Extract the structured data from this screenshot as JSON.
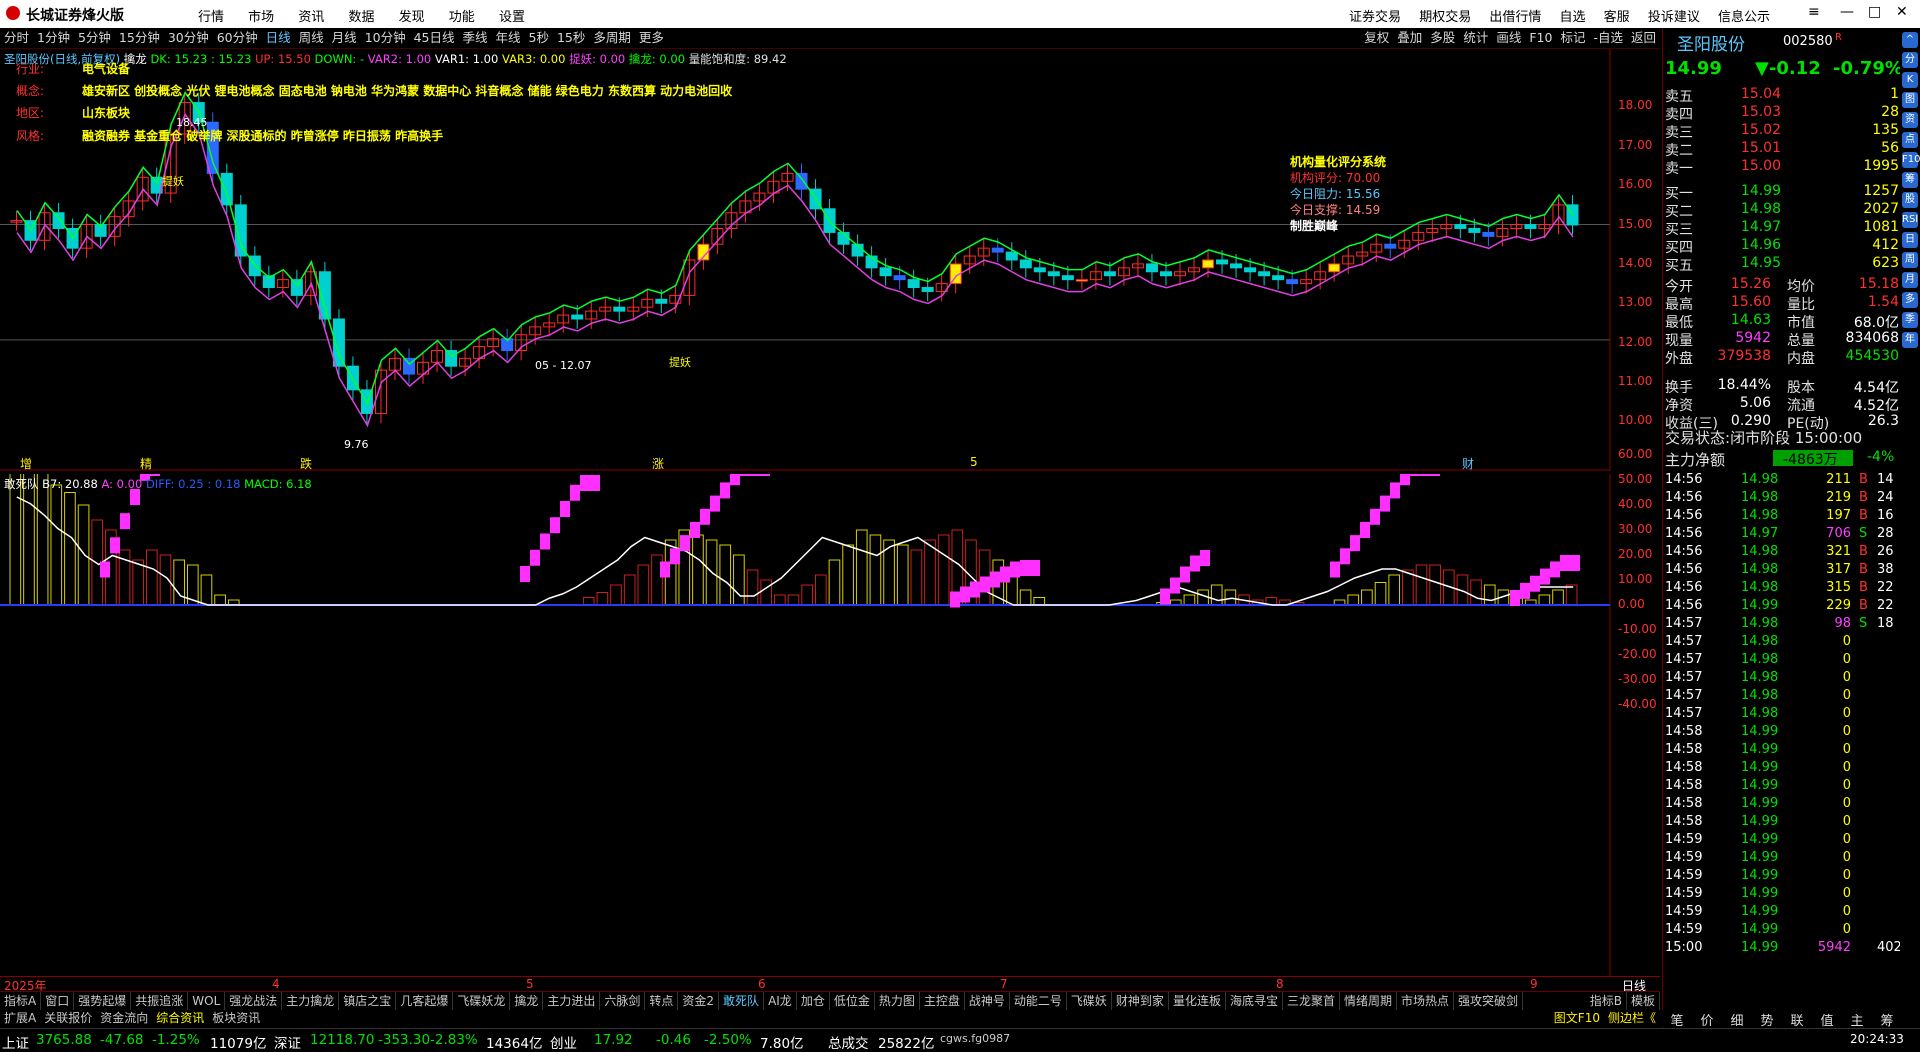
{
  "titlebar": {
    "app": "长城证券烽火版",
    "menu": [
      "行情",
      "市场",
      "资讯",
      "数据",
      "发现",
      "功能",
      "设置"
    ],
    "right_menu": [
      "证券交易",
      "期权交易",
      "出借行情",
      "自选",
      "客服",
      "投诉建议",
      "信息公示"
    ]
  },
  "periods": [
    "分时",
    "1分钟",
    "5分钟",
    "15分钟",
    "30分钟",
    "60分钟",
    "日线",
    "周线",
    "月线",
    "10分钟",
    "45日线",
    "季线",
    "年线",
    "5秒",
    "15秒",
    "多周期",
    "更多"
  ],
  "selected_period": "日线",
  "tools": [
    "复权",
    "叠加",
    "多股",
    "统计",
    "画线",
    "F10",
    "标记",
    "-自选",
    "返回"
  ],
  "kline": {
    "header": [
      {
        "t": "圣阳股份(日线,前复权)",
        "c": "#5ac8ff"
      },
      {
        "t": "  擒龙 ",
        "c": "#ffffff"
      },
      {
        "t": "DK: 15.23 : 15.23 ",
        "c": "#00ff00"
      },
      {
        "t": "UP: 15.50 ",
        "c": "#ff3030"
      },
      {
        "t": "DOWN: - ",
        "c": "#00ff00"
      },
      {
        "t": "VAR2: 1.00 ",
        "c": "#ff40ff"
      },
      {
        "t": "VAR1: 1.00 ",
        "c": "#ffffff"
      },
      {
        "t": "VAR3: 0.00 ",
        "c": "#ffff00"
      },
      {
        "t": "捉妖: 0.00 ",
        "c": "#ff40ff"
      },
      {
        "t": "擒龙: 0.00 ",
        "c": "#00ff00"
      },
      {
        "t": "量能饱和度: 89.42",
        "c": "#e0e0e0"
      }
    ],
    "info": [
      {
        "label": "行业:",
        "value": "电气设备"
      },
      {
        "label": "概念:",
        "value": "雄安新区 创投概念 光伏 锂电池概念 固态电池 钠电池 华为鸿蒙 数据中心 抖音概念 储能 绿色电力 东数西算 动力电池回收"
      },
      {
        "label": "地区:",
        "value": "山东板块"
      },
      {
        "label": "风格:",
        "value": "融资融券 基金重仓 破举牌 深股通标的 昨曾涨停 昨日振荡 昨高换手"
      }
    ],
    "y_ticks": [
      "18.00",
      "17.00",
      "16.00",
      "15.00",
      "14.00",
      "13.00",
      "12.00",
      "11.00",
      "10.00"
    ],
    "score": {
      "title": "机构量化评分系统",
      "rows": [
        {
          "label": "机构评分: ",
          "value": "70.00",
          "color": "#ff3030"
        },
        {
          "label": "今日阻力: ",
          "value": "15.56",
          "color": "#5ac8ff"
        },
        {
          "label": "今日支撑: ",
          "value": "14.59",
          "color": "#ff8080"
        }
      ],
      "footer": "制胜巅峰"
    },
    "annotations": {
      "high": "18.45",
      "low": "9.76",
      "range": "05 - 12.07",
      "tag1": "提妖",
      "tag2": "提妖"
    },
    "bottom_marks": [
      "增",
      "精",
      "跌",
      "涨",
      "5",
      "财"
    ]
  },
  "macd": {
    "header": [
      {
        "t": "敢死队 ",
        "c": "#ffffff"
      },
      {
        "t": "B7: 20.88 ",
        "c": "#ffffff"
      },
      {
        "t": "A: 0.00 ",
        "c": "#ff40ff"
      },
      {
        "t": "DIFF: 0.25 : 0.18 ",
        "c": "#2a5aff"
      },
      {
        "t": "MACD: 6.18",
        "c": "#00ff00"
      }
    ],
    "y_ticks": [
      "60.00",
      "50.00",
      "40.00",
      "30.00",
      "20.00",
      "10.00",
      "0.00",
      "-10.00",
      "-20.00",
      "-30.00",
      "-40.00"
    ]
  },
  "x_axis": {
    "year": "2025年",
    "months": [
      "4",
      "5",
      "6",
      "7",
      "8",
      "9"
    ],
    "mode": "日线"
  },
  "chart_data": {
    "type": "candlestick",
    "title": "圣阳股份(日线,前复权)",
    "ylim": [
      9.5,
      18.8
    ],
    "note": "approximate daily close path",
    "close": [
      15.1,
      14.6,
      15.3,
      14.9,
      14.4,
      15.0,
      14.7,
      15.2,
      15.6,
      16.2,
      15.8,
      17.3,
      18.1,
      17.6,
      16.3,
      15.5,
      14.2,
      13.7,
      13.4,
      13.6,
      13.2,
      13.8,
      12.6,
      11.4,
      10.8,
      10.2,
      11.3,
      11.6,
      11.2,
      11.5,
      11.8,
      11.4,
      11.6,
      11.9,
      12.1,
      11.8,
      12.2,
      12.4,
      12.5,
      12.7,
      12.6,
      12.8,
      12.9,
      12.8,
      12.9,
      13.1,
      13.0,
      13.2,
      14.1,
      14.5,
      14.9,
      15.3,
      15.6,
      15.8,
      16.1,
      16.3,
      15.9,
      15.4,
      14.8,
      14.5,
      14.2,
      13.9,
      13.7,
      13.6,
      13.4,
      13.3,
      13.5,
      14.0,
      14.2,
      14.4,
      14.3,
      14.1,
      13.9,
      13.8,
      13.7,
      13.6,
      13.6,
      13.8,
      13.7,
      13.9,
      14.0,
      13.8,
      13.7,
      13.8,
      13.9,
      14.1,
      14.0,
      13.9,
      13.8,
      13.7,
      13.6,
      13.5,
      13.6,
      13.8,
      14.0,
      14.2,
      14.3,
      14.5,
      14.4,
      14.6,
      14.8,
      14.9,
      15.0,
      14.9,
      14.8,
      14.7,
      14.9,
      15.0,
      14.9,
      15.0,
      15.5,
      14.99
    ],
    "volume_bars": [
      64,
      60,
      54,
      48,
      45,
      40,
      34,
      30,
      22,
      18,
      22,
      20,
      18,
      16,
      12,
      4,
      2,
      0,
      0,
      0,
      0,
      0,
      0,
      0,
      0,
      0,
      0,
      0,
      0,
      0,
      0,
      0,
      0,
      0,
      0,
      0,
      0,
      0,
      0,
      0,
      0,
      0,
      3,
      5,
      8,
      12,
      16,
      20,
      26,
      30,
      28,
      26,
      24,
      20,
      14,
      10,
      4,
      4,
      8,
      12,
      18,
      24,
      30,
      28,
      26,
      24,
      22,
      26,
      28,
      30,
      26,
      22,
      18,
      12,
      6,
      3,
      0,
      0,
      0,
      0,
      0,
      0,
      0,
      0,
      1,
      2,
      4,
      6,
      8,
      6,
      4,
      2,
      3,
      2,
      1,
      0,
      0,
      2,
      4,
      6,
      9,
      12,
      14,
      16,
      16,
      14,
      12,
      10,
      8,
      6,
      3,
      2,
      4,
      6,
      8
    ]
  },
  "quote": {
    "name": "圣阳股份",
    "code": "002580",
    "flag": "R",
    "price": "14.99",
    "change": "▼-0.12",
    "pct": "-0.79%",
    "asks": [
      {
        "l": "卖五",
        "p": "15.04",
        "v": "1"
      },
      {
        "l": "卖四",
        "p": "15.03",
        "v": "28"
      },
      {
        "l": "卖三",
        "p": "15.02",
        "v": "135"
      },
      {
        "l": "卖二",
        "p": "15.01",
        "v": "56"
      },
      {
        "l": "卖一",
        "p": "15.00",
        "v": "1995"
      }
    ],
    "bids": [
      {
        "l": "买一",
        "p": "14.99",
        "v": "1257"
      },
      {
        "l": "买二",
        "p": "14.98",
        "v": "2027"
      },
      {
        "l": "买三",
        "p": "14.97",
        "v": "1081"
      },
      {
        "l": "买四",
        "p": "14.96",
        "v": "412"
      },
      {
        "l": "买五",
        "p": "14.95",
        "v": "623"
      }
    ],
    "stats": [
      {
        "a": "今开",
        "av": "15.26",
        "b": "均价",
        "bv": "15.18",
        "ac": "red",
        "bc": "red"
      },
      {
        "a": "最高",
        "av": "15.60",
        "b": "量比",
        "bv": "1.54",
        "ac": "red",
        "bc": "red"
      },
      {
        "a": "最低",
        "av": "14.63",
        "b": "市值",
        "bv": "68.0亿",
        "ac": "grn",
        "bc": "wht"
      },
      {
        "a": "现量",
        "av": "5942",
        "b": "总量",
        "bv": "834068",
        "ac": "mag",
        "bc": "wht"
      },
      {
        "a": "外盘",
        "av": "379538",
        "b": "内盘",
        "bv": "454530",
        "ac": "red",
        "bc": "grn"
      },
      {
        "a": "换手",
        "av": "18.44%",
        "b": "股本",
        "bv": "4.54亿",
        "ac": "wht",
        "bc": "wht"
      },
      {
        "a": "净资",
        "av": "5.06",
        "b": "流通",
        "bv": "4.52亿",
        "ac": "wht",
        "bc": "wht"
      },
      {
        "a": "收益(三)",
        "av": "0.290",
        "b": "PE(动)",
        "bv": "26.3",
        "ac": "wht",
        "bc": "wht"
      }
    ],
    "trade_status_label": "交易状态:",
    "trade_status": "闭市阶段 15:00:00",
    "net_label": "主力净额",
    "net_value": "-4863万",
    "net_pct": "-4%",
    "ticks": [
      {
        "t": "14:56",
        "p": "14.98",
        "v": "211",
        "d": "B",
        "n": "14"
      },
      {
        "t": "14:56",
        "p": "14.98",
        "v": "219",
        "d": "B",
        "n": "24"
      },
      {
        "t": "14:56",
        "p": "14.98",
        "v": "197",
        "d": "B",
        "n": "16"
      },
      {
        "t": "14:56",
        "p": "14.97",
        "v": "706",
        "d": "S",
        "n": "28"
      },
      {
        "t": "14:56",
        "p": "14.98",
        "v": "321",
        "d": "B",
        "n": "26"
      },
      {
        "t": "14:56",
        "p": "14.98",
        "v": "317",
        "d": "B",
        "n": "38"
      },
      {
        "t": "14:56",
        "p": "14.98",
        "v": "315",
        "d": "B",
        "n": "22"
      },
      {
        "t": "14:56",
        "p": "14.99",
        "v": "229",
        "d": "B",
        "n": "22"
      },
      {
        "t": "14:57",
        "p": "14.98",
        "v": "98",
        "d": "S",
        "n": "18"
      },
      {
        "t": "14:57",
        "p": "14.98",
        "v": "0",
        "d": "",
        "n": ""
      },
      {
        "t": "14:57",
        "p": "14.98",
        "v": "0",
        "d": "",
        "n": ""
      },
      {
        "t": "14:57",
        "p": "14.98",
        "v": "0",
        "d": "",
        "n": ""
      },
      {
        "t": "14:57",
        "p": "14.98",
        "v": "0",
        "d": "",
        "n": ""
      },
      {
        "t": "14:57",
        "p": "14.98",
        "v": "0",
        "d": "",
        "n": ""
      },
      {
        "t": "14:58",
        "p": "14.99",
        "v": "0",
        "d": "",
        "n": ""
      },
      {
        "t": "14:58",
        "p": "14.99",
        "v": "0",
        "d": "",
        "n": ""
      },
      {
        "t": "14:58",
        "p": "14.99",
        "v": "0",
        "d": "",
        "n": ""
      },
      {
        "t": "14:58",
        "p": "14.99",
        "v": "0",
        "d": "",
        "n": ""
      },
      {
        "t": "14:58",
        "p": "14.99",
        "v": "0",
        "d": "",
        "n": ""
      },
      {
        "t": "14:58",
        "p": "14.99",
        "v": "0",
        "d": "",
        "n": ""
      },
      {
        "t": "14:59",
        "p": "14.99",
        "v": "0",
        "d": "",
        "n": ""
      },
      {
        "t": "14:59",
        "p": "14.99",
        "v": "0",
        "d": "",
        "n": ""
      },
      {
        "t": "14:59",
        "p": "14.99",
        "v": "0",
        "d": "",
        "n": ""
      },
      {
        "t": "14:59",
        "p": "14.99",
        "v": "0",
        "d": "",
        "n": ""
      },
      {
        "t": "14:59",
        "p": "14.99",
        "v": "0",
        "d": "",
        "n": ""
      },
      {
        "t": "14:59",
        "p": "14.99",
        "v": "0",
        "d": "",
        "n": ""
      },
      {
        "t": "15:00",
        "p": "14.99",
        "v": "5942",
        "d": "",
        "n": "402"
      }
    ]
  },
  "rstrip": [
    "^",
    "分",
    "K",
    "图",
    "资",
    "点",
    "F10",
    "筹",
    "股",
    "RSI",
    "日",
    "周",
    "月",
    "多",
    "季",
    "年"
  ],
  "tabs1": [
    "指标A",
    "窗口",
    "强势起爆",
    "共振追涨",
    "WOL",
    "强龙战法",
    "主力擒龙",
    "镇店之宝",
    "几客起爆",
    "飞碟妖龙",
    "擒龙",
    "主力进出",
    "六脉剑",
    "转点",
    "资金2",
    "敢死队",
    "AI龙",
    "加仓",
    "低位金",
    "热力图",
    "主控盘",
    "战神号",
    "动能二号",
    "飞碟妖",
    "财神到家",
    "量化连板",
    "海底寻宝",
    "三龙聚首",
    "情绪周期",
    "市场热点",
    "强攻突破剑"
  ],
  "tabs1_sel": "敢死队",
  "tabs1_right": [
    "指标B",
    "模板"
  ],
  "tabs2": [
    "扩展A",
    "关联报价",
    "资金流向",
    "综合资讯",
    "板块资讯"
  ],
  "tabs2_sel": "综合资讯",
  "tabs2_right": [
    "图文F10",
    "侧边栏《"
  ],
  "rbtabs": [
    "笔",
    "价",
    "细",
    "势",
    "联",
    "值",
    "主",
    "筹"
  ],
  "status": {
    "sh_l": "上证",
    "sh": "3765.88",
    "sh_c": "-47.68",
    "sh_p": "-1.25%",
    "sh_a": "11079亿",
    "sz_l": "深证",
    "sz": "12118.70",
    "sz_c": "-353.30",
    "sz_p": "-2.83%",
    "sz_a": "14364亿",
    "cy_l": "创业",
    "cy": "17.92",
    "cy_c": "-0.46",
    "cy_p": "-2.50%",
    "cy_a": "7.80亿",
    "total_l": "总成交",
    "total": "25822亿",
    "user": "cgws.fg0987",
    "time": "20:24:33"
  }
}
